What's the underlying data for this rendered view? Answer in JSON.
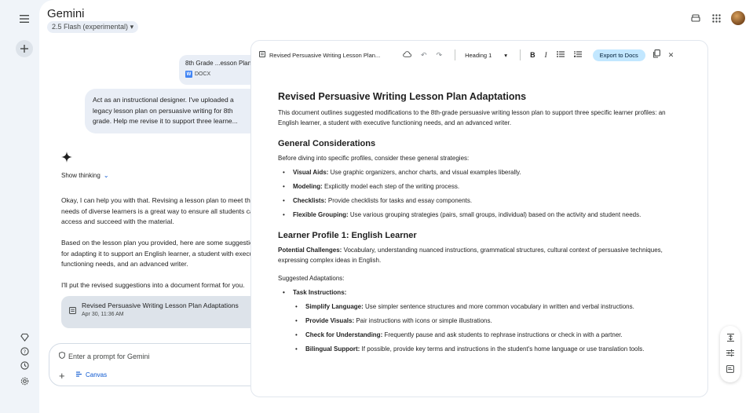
{
  "app": {
    "title": "Gemini",
    "model": "2.5 Flash (experimental)"
  },
  "upload": {
    "file_name": "8th Grade ...esson Plan",
    "file_type": "DOCX",
    "badge": "W"
  },
  "user_prompt": "Act as an instructional designer. I've uploaded a legacy lesson plan on persuasive writing for 8th grade. Help me revise it to support three learne...",
  "response": {
    "show_thinking": "Show thinking",
    "paragraphs": [
      "Okay, I can help you with that. Revising a lesson plan to meet the needs of diverse learners is a great way to ensure all students can access and succeed with the material.",
      "Based on the lesson plan you provided, here are some suggestions for adapting it to support an English learner, a student with executive functioning needs, and an advanced writer.",
      "I'll put the revised suggestions into a document format for you."
    ],
    "doc_card": {
      "title": "Revised Persuasive Writing Lesson Plan Adaptations",
      "date": "Apr 30, 11:36 AM"
    }
  },
  "input": {
    "placeholder": "Enter a prompt for Gemini",
    "canvas_label": "Canvas"
  },
  "canvas": {
    "toolbar": {
      "title": "Revised Persuasive Writing Lesson Plan...",
      "heading": "Heading 1",
      "bold": "B",
      "italic": "I",
      "export": "Export to Docs"
    },
    "doc": {
      "title": "Revised Persuasive Writing Lesson Plan Adaptations",
      "intro": "This document outlines suggested modifications to the 8th-grade persuasive writing lesson plan to support three specific learner profiles: an English learner, a student with executive functioning needs, and an advanced writer.",
      "general": {
        "heading": "General Considerations",
        "lead": "Before diving into specific profiles, consider these general strategies:",
        "items": [
          {
            "label": "Visual Aids:",
            "text": " Use graphic organizers, anchor charts, and visual examples liberally."
          },
          {
            "label": "Modeling:",
            "text": " Explicitly model each step of the writing process."
          },
          {
            "label": "Checklists:",
            "text": " Provide checklists for tasks and essay components."
          },
          {
            "label": "Flexible Grouping:",
            "text": " Use various grouping strategies (pairs, small groups, individual) based on the activity and student needs."
          }
        ]
      },
      "profile1": {
        "heading": "Learner Profile 1: English Learner",
        "challenges_label": "Potential Challenges:",
        "challenges_text": " Vocabulary, understanding nuanced instructions, grammatical structures, cultural context of persuasive techniques, expressing complex ideas in English.",
        "suggested": "Suggested Adaptations:",
        "task_label": "Task Instructions:",
        "sub_items": [
          {
            "label": "Simplify Language:",
            "text": " Use simpler sentence structures and more common vocabulary in written and verbal instructions."
          },
          {
            "label": "Provide Visuals:",
            "text": " Pair instructions with icons or simple illustrations."
          },
          {
            "label": "Check for Understanding:",
            "text": " Frequently pause and ask students to rephrase instructions or check in with a partner."
          },
          {
            "label": "Bilingual Support:",
            "text": " If possible, provide key terms and instructions in the student's home language or use translation tools."
          }
        ]
      }
    }
  }
}
